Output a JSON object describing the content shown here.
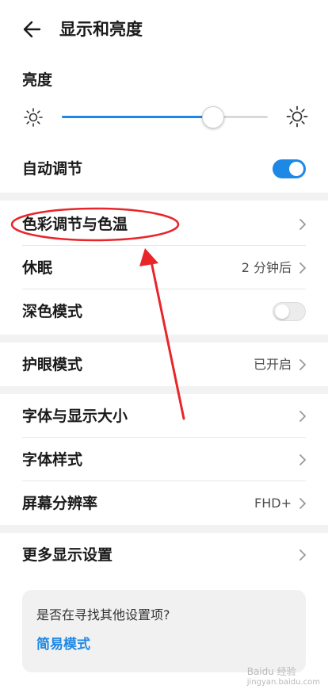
{
  "header": {
    "title": "显示和亮度",
    "back_icon": "arrow-left-icon"
  },
  "brightness": {
    "label": "亮度",
    "level_percent": 73
  },
  "auto_adjust": {
    "label": "自动调节",
    "enabled": true
  },
  "rows": {
    "color": {
      "label": "色彩调节与色温"
    },
    "sleep": {
      "label": "休眠",
      "value": "2 分钟后"
    },
    "dark": {
      "label": "深色模式",
      "enabled": false
    },
    "eye": {
      "label": "护眼模式",
      "value": "已开启"
    },
    "font_size": {
      "label": "字体与显示大小"
    },
    "font_style": {
      "label": "字体样式"
    },
    "resolution": {
      "label": "屏幕分辨率",
      "value": "FHD+"
    },
    "more": {
      "label": "更多显示设置"
    }
  },
  "hint": {
    "question": "是否在寻找其他设置项?",
    "link": "简易模式"
  },
  "watermark": {
    "text": "Baidu 经验",
    "sub": "jingyan.baidu.com"
  },
  "colors": {
    "accent": "#1e88e5",
    "annotation": "#e8262a"
  }
}
